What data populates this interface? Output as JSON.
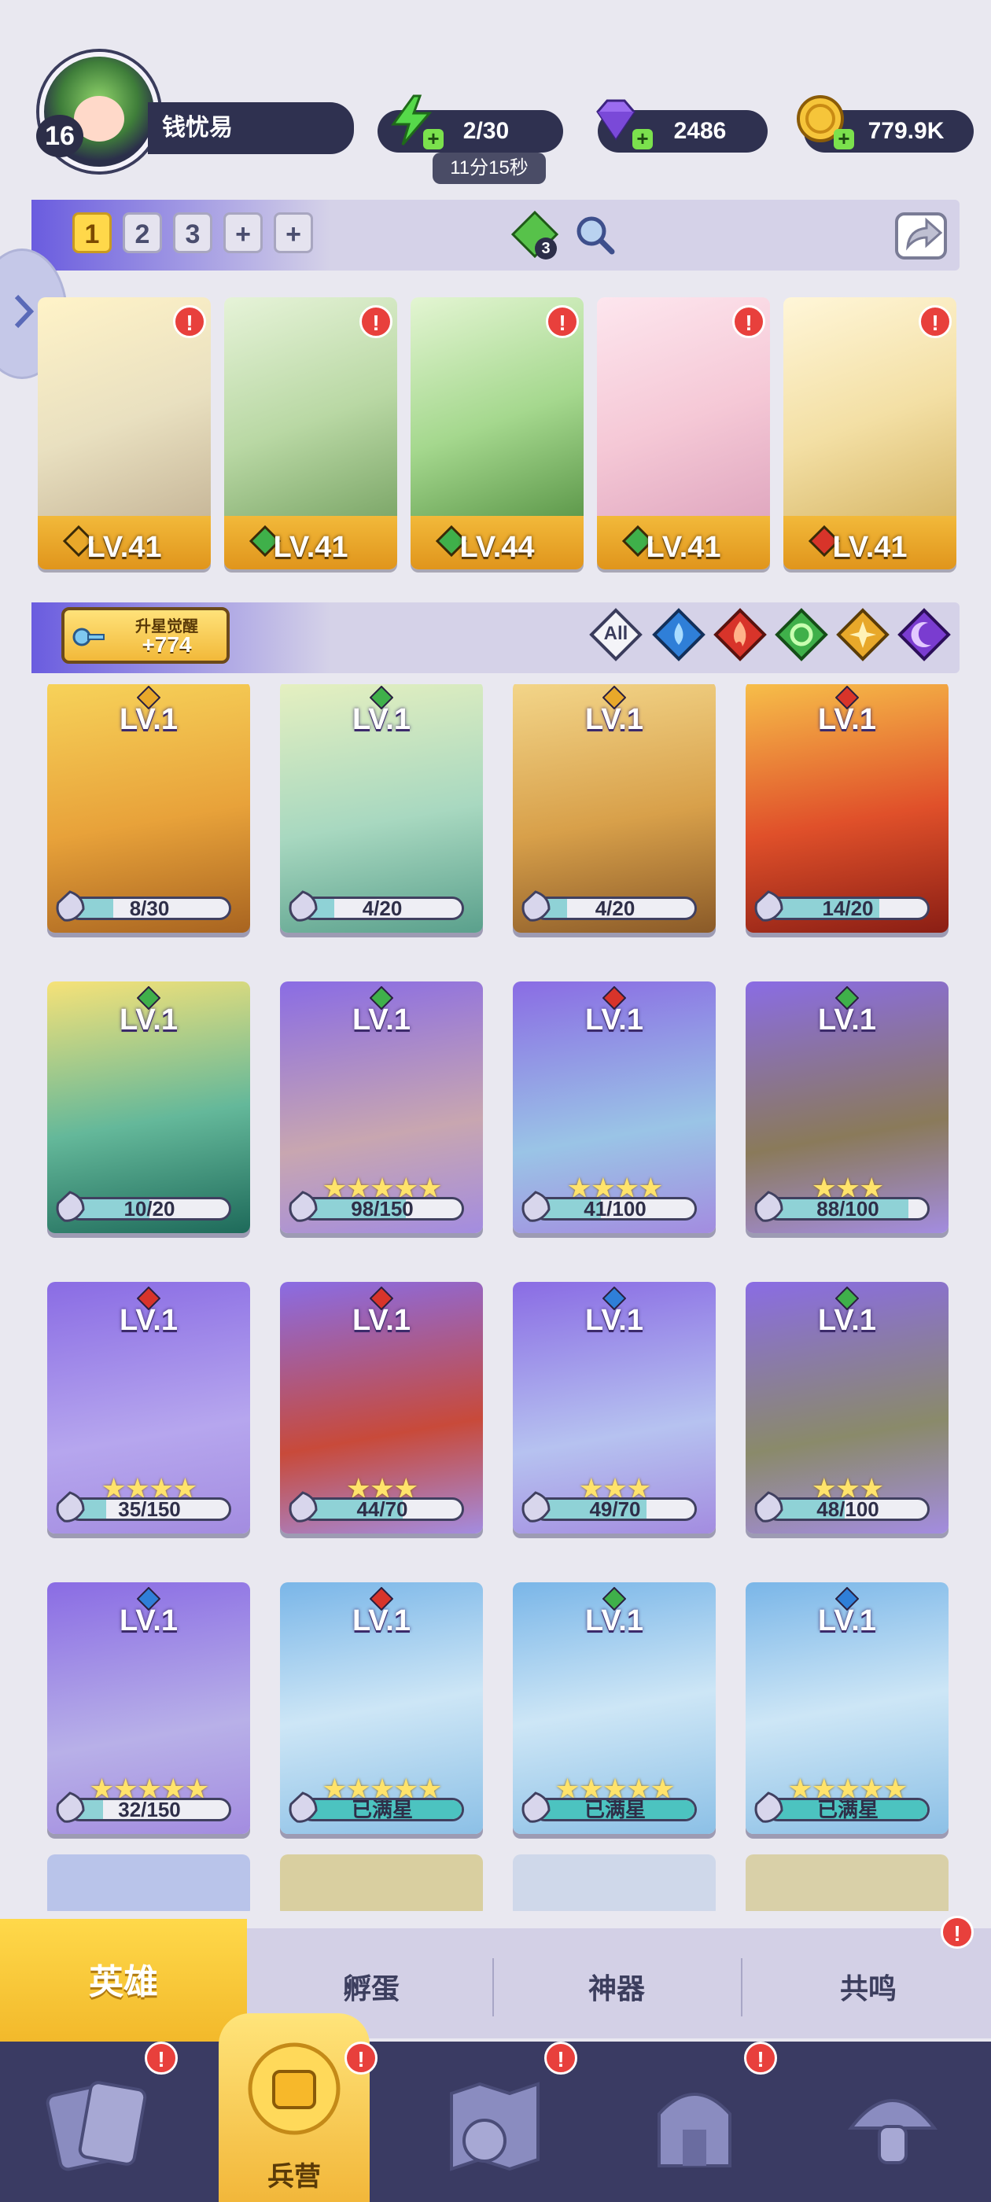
{
  "player": {
    "level": "16",
    "name": "钱忧易"
  },
  "resources": {
    "energy": {
      "value": "2/30",
      "timer": "11分15秒",
      "icon": "lightning-icon"
    },
    "gems": {
      "value": "2486",
      "icon": "diamond-icon"
    },
    "coins": {
      "value": "779.9K",
      "icon": "coin-icon"
    }
  },
  "team": {
    "slots": [
      "1",
      "2",
      "3",
      "+",
      "+"
    ],
    "active_slot": "1",
    "counter": "3"
  },
  "team_heroes": [
    {
      "level": "LV.41",
      "element": "light",
      "alert": "!"
    },
    {
      "level": "LV.41",
      "element": "wind",
      "alert": "!"
    },
    {
      "level": "LV.44",
      "element": "wind",
      "alert": "!"
    },
    {
      "level": "LV.41",
      "element": "wind",
      "alert": "!"
    },
    {
      "level": "LV.41",
      "element": "fire",
      "alert": "!"
    }
  ],
  "awaken": {
    "label": "升星觉醒",
    "value": "+774"
  },
  "filters": [
    {
      "label": "All",
      "icon": "all-filter-icon"
    },
    {
      "icon": "water-element-icon"
    },
    {
      "icon": "fire-element-icon"
    },
    {
      "icon": "wind-element-icon"
    },
    {
      "icon": "light-element-icon"
    },
    {
      "icon": "dark-element-icon"
    }
  ],
  "roster": [
    {
      "level": "LV.1",
      "stars": 0,
      "progress": "8/30",
      "fraction": 0.27,
      "rarity": "gold"
    },
    {
      "level": "LV.1",
      "stars": 0,
      "progress": "4/20",
      "fraction": 0.2,
      "rarity": "gold"
    },
    {
      "level": "LV.1",
      "stars": 0,
      "progress": "4/20",
      "fraction": 0.2,
      "rarity": "gold"
    },
    {
      "level": "LV.1",
      "stars": 0,
      "progress": "14/20",
      "fraction": 0.7,
      "rarity": "gold"
    },
    {
      "level": "LV.1",
      "stars": 0,
      "progress": "10/20",
      "fraction": 0.5,
      "rarity": "gold"
    },
    {
      "level": "LV.1",
      "stars": 5,
      "progress": "98/150",
      "fraction": 0.65,
      "rarity": "purple"
    },
    {
      "level": "LV.1",
      "stars": 4,
      "progress": "41/100",
      "fraction": 0.41,
      "rarity": "purple"
    },
    {
      "level": "LV.1",
      "stars": 3,
      "progress": "88/100",
      "fraction": 0.88,
      "rarity": "purple"
    },
    {
      "level": "LV.1",
      "stars": 4,
      "progress": "35/150",
      "fraction": 0.23,
      "rarity": "purple"
    },
    {
      "level": "LV.1",
      "stars": 3,
      "progress": "44/70",
      "fraction": 0.63,
      "rarity": "purple"
    },
    {
      "level": "LV.1",
      "stars": 3,
      "progress": "49/70",
      "fraction": 0.7,
      "rarity": "purple"
    },
    {
      "level": "LV.1",
      "stars": 3,
      "progress": "48/100",
      "fraction": 0.48,
      "rarity": "purple"
    },
    {
      "level": "LV.1",
      "stars": 5,
      "progress": "32/150",
      "fraction": 0.21,
      "rarity": "purple"
    },
    {
      "level": "LV.1",
      "stars": 5,
      "progress": "已满星",
      "fraction": 1,
      "rarity": "blue"
    },
    {
      "level": "LV.1",
      "stars": 5,
      "progress": "已满星",
      "fraction": 1,
      "rarity": "blue"
    },
    {
      "level": "LV.1",
      "stars": 5,
      "progress": "已满星",
      "fraction": 1,
      "rarity": "blue"
    }
  ],
  "sub_tabs": [
    "英雄",
    "孵蛋",
    "神器",
    "共鸣"
  ],
  "bottom_nav": {
    "active_label": "兵营",
    "items": [
      "cards-icon",
      "barracks-icon",
      "map-icon",
      "temple-icon",
      "mushroom-icon"
    ]
  },
  "colors": {
    "accent_gold": "#f2b93a",
    "alert_red": "#e8403c",
    "nav_dark": "#3a3b63"
  }
}
